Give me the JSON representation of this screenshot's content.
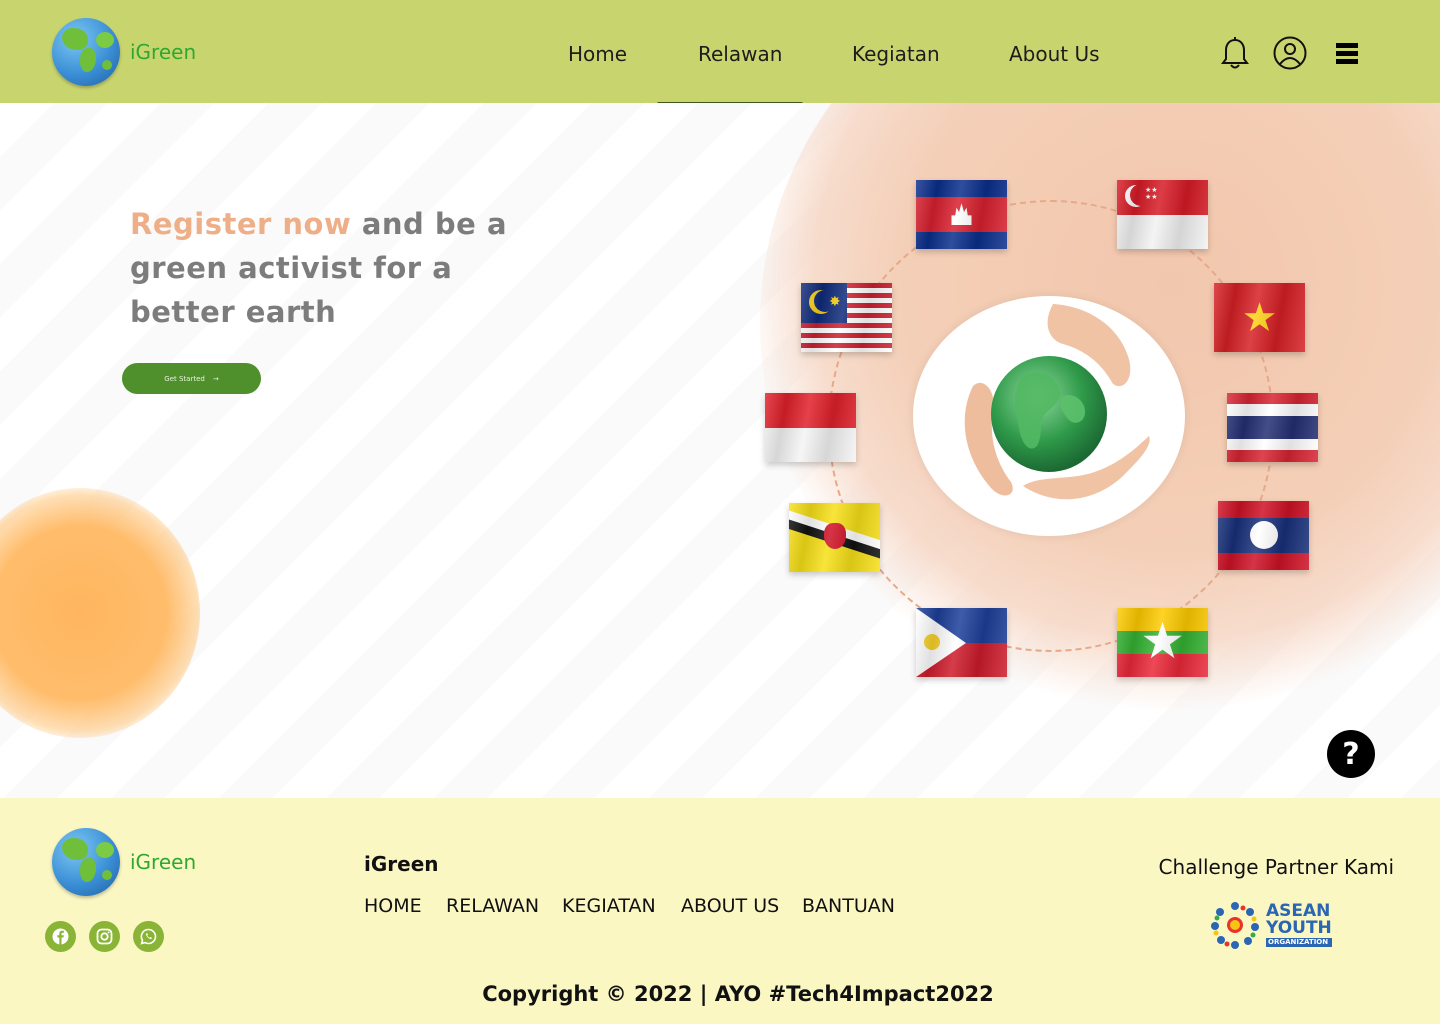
{
  "brand": {
    "name": "iGreen"
  },
  "nav": {
    "items": [
      {
        "label": "Home"
      },
      {
        "label": "Relawan"
      },
      {
        "label": "Kegiatan"
      },
      {
        "label": "About Us"
      }
    ],
    "active": "Relawan"
  },
  "header_icons": {
    "notifications": "bell-icon",
    "profile": "user-circle-icon",
    "menu": "hamburger-menu-icon"
  },
  "hero": {
    "headline_accent": "Register now",
    "headline_rest": " and be a green activist for a better earth",
    "cta_label": "Get Started",
    "cta_icon": "arrow-right-icon",
    "flags": [
      "Cambodia",
      "Singapore",
      "Malaysia",
      "Vietnam",
      "Indonesia",
      "Thailand",
      "Brunei",
      "Laos",
      "Philippines",
      "Myanmar"
    ]
  },
  "help": {
    "label": "?"
  },
  "footer": {
    "brand": "iGreen",
    "links": [
      {
        "label": "HOME"
      },
      {
        "label": "RELAWAN"
      },
      {
        "label": "KEGIATAN"
      },
      {
        "label": "ABOUT US"
      },
      {
        "label": "BANTUAN"
      }
    ],
    "social": [
      "facebook-icon",
      "instagram-icon",
      "whatsapp-icon"
    ],
    "partner_title": "Challenge Partner Kami",
    "partner_logo": {
      "line1": "ASEAN",
      "line2": "YOUTH",
      "line3": "ORGANIZATION"
    },
    "copyright": "Copyright © 2022 | AYO #Tech4Impact2022"
  },
  "colors": {
    "header_bg": "#c8d56f",
    "footer_bg": "#fbf7c3",
    "accent_peach": "#eeae88",
    "cta_green": "#4f8f2c",
    "logo_green": "#2fa831"
  }
}
